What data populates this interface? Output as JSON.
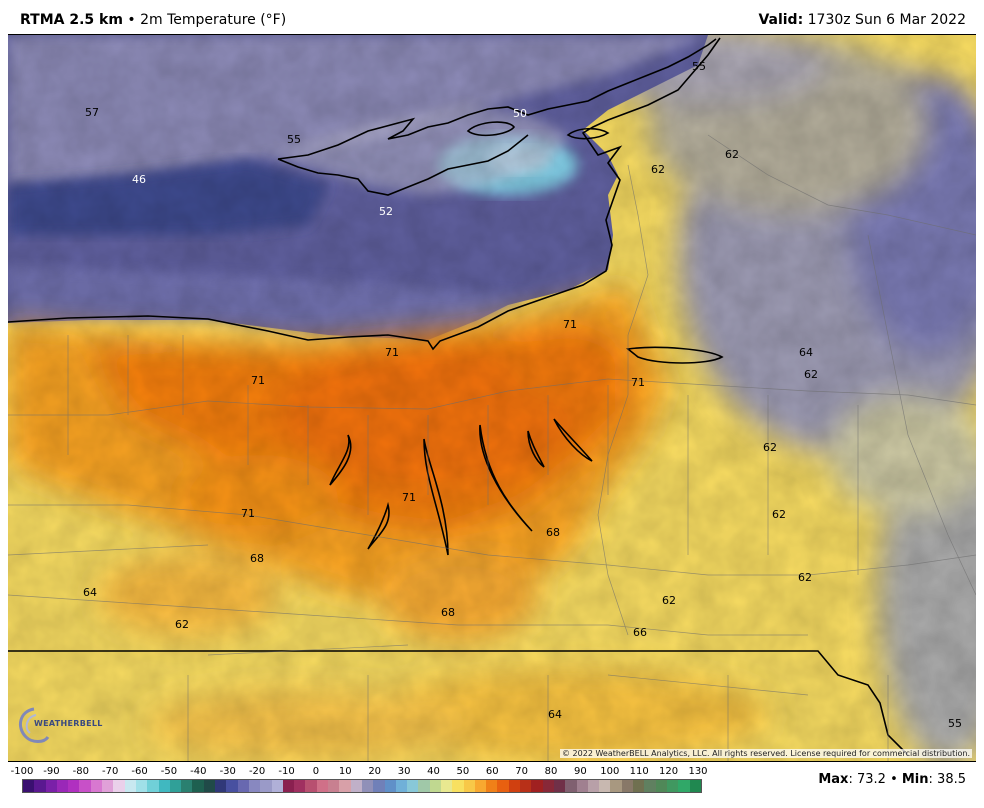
{
  "header": {
    "model": "RTMA 2.5 km",
    "separator": "•",
    "field": "2m Temperature (°F)",
    "valid_label": "Valid:",
    "valid_time": "1730z Sun 6 Mar 2022"
  },
  "map": {
    "copyright": "© 2022 WeatherBELL Analytics, LLC. All rights reserved. License required for commercial distribution.",
    "logo_text": "WEATHERBELL",
    "labels": [
      {
        "text": "57",
        "color": "#000000"
      },
      {
        "text": "55",
        "color": "#000000"
      },
      {
        "text": "46",
        "color": "#ffffff"
      },
      {
        "text": "52",
        "color": "#ffffff"
      },
      {
        "text": "50",
        "color": "#ffffff"
      },
      {
        "text": "55",
        "color": "#000000"
      },
      {
        "text": "62",
        "color": "#000000"
      },
      {
        "text": "62",
        "color": "#000000"
      },
      {
        "text": "71",
        "color": "#000000"
      },
      {
        "text": "71",
        "color": "#000000"
      },
      {
        "text": "71",
        "color": "#000000"
      },
      {
        "text": "71",
        "color": "#000000"
      },
      {
        "text": "64",
        "color": "#000000"
      },
      {
        "text": "62",
        "color": "#000000"
      },
      {
        "text": "62",
        "color": "#000000"
      },
      {
        "text": "71",
        "color": "#000000"
      },
      {
        "text": "71",
        "color": "#000000"
      },
      {
        "text": "68",
        "color": "#000000"
      },
      {
        "text": "62",
        "color": "#000000"
      },
      {
        "text": "68",
        "color": "#000000"
      },
      {
        "text": "62",
        "color": "#000000"
      },
      {
        "text": "64",
        "color": "#000000"
      },
      {
        "text": "68",
        "color": "#000000"
      },
      {
        "text": "62",
        "color": "#000000"
      },
      {
        "text": "62",
        "color": "#000000"
      },
      {
        "text": "66",
        "color": "#000000"
      },
      {
        "text": "64",
        "color": "#000000"
      },
      {
        "text": "55",
        "color": "#000000"
      }
    ]
  },
  "legend": {
    "ticks": [
      "-100",
      "-90",
      "-80",
      "-70",
      "-60",
      "-50",
      "-40",
      "-30",
      "-20",
      "-10",
      "0",
      "10",
      "20",
      "30",
      "40",
      "50",
      "60",
      "70",
      "80",
      "90",
      "100",
      "110",
      "120",
      "130"
    ],
    "colors": [
      "#3a1070",
      "#5a1890",
      "#7a20a8",
      "#9a28b8",
      "#b030c0",
      "#c850c8",
      "#d878d0",
      "#e0a0d8",
      "#ead0ea",
      "#c8e8f0",
      "#a0e0e8",
      "#70d0d8",
      "#40b8c0",
      "#30a098",
      "#2a8070",
      "#1e6050",
      "#204a48",
      "#303878",
      "#4850a0",
      "#6868b0",
      "#8888c0",
      "#9a9ac8",
      "#b0b0d8",
      "#8a2050",
      "#a03060",
      "#b85070",
      "#d07088",
      "#c88090",
      "#d8a0a8",
      "#c0b0c8",
      "#9090b8",
      "#7080b8",
      "#6090c8",
      "#70b0d8",
      "#88c8d8",
      "#a0c8a8",
      "#c0d890",
      "#e8e890",
      "#f8e060",
      "#f8c848",
      "#f8a830",
      "#f08018",
      "#e86010",
      "#d04010",
      "#b83018",
      "#a02020",
      "#882838",
      "#703048",
      "#806070",
      "#a08090",
      "#b8a0a8",
      "#c8b8b0",
      "#a89880",
      "#887868",
      "#707050",
      "#608060",
      "#508858",
      "#409860",
      "#30a868",
      "#208850"
    ]
  },
  "stats": {
    "max_label": "Max",
    "max_value": "73.2",
    "sep": "•",
    "min_label": "Min",
    "min_value": "38.5"
  }
}
